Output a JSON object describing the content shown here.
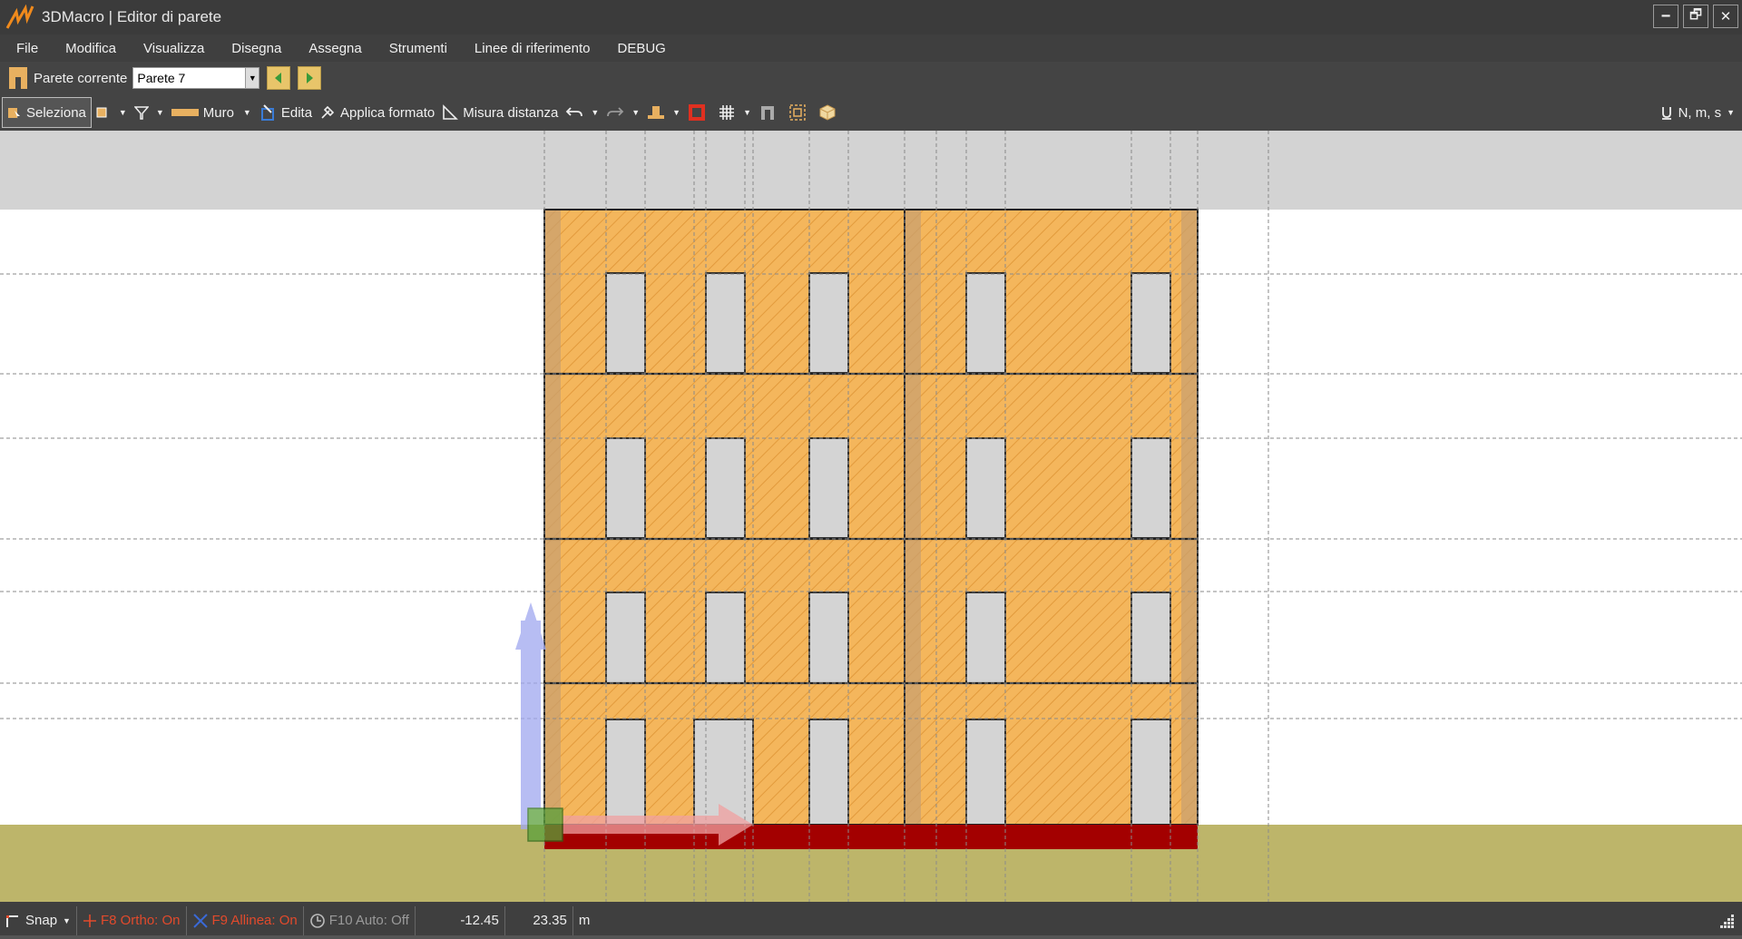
{
  "window": {
    "title": "3DMacro | Editor di parete",
    "minimize": "🗕",
    "restore": "🗗",
    "close": "✕"
  },
  "menu": {
    "items": [
      "File",
      "Modifica",
      "Visualizza",
      "Disegna",
      "Assegna",
      "Strumenti",
      "Linee di riferimento",
      "DEBUG"
    ]
  },
  "wallbar": {
    "label": "Parete corrente",
    "selected": "Parete 7"
  },
  "toolbar": {
    "select": "Seleziona",
    "wall": "Muro",
    "edit": "Edita",
    "apply_format": "Applica formato",
    "measure": "Misura distanza",
    "units": "N, m, s"
  },
  "statusbar": {
    "snap": "Snap",
    "ortho": "F8 Ortho: On",
    "align": "F9 Allinea: On",
    "auto": "F10 Auto: Off",
    "x": "-12.45",
    "y": "23.35",
    "unit": "m"
  },
  "colors": {
    "wall_fill": "#f4b65c",
    "ground": "#bdb56a",
    "foundation": "#a30000",
    "opening": "#d4d4d4",
    "sky_band": "#d3d3d3",
    "accent_red": "#e24a2c"
  }
}
